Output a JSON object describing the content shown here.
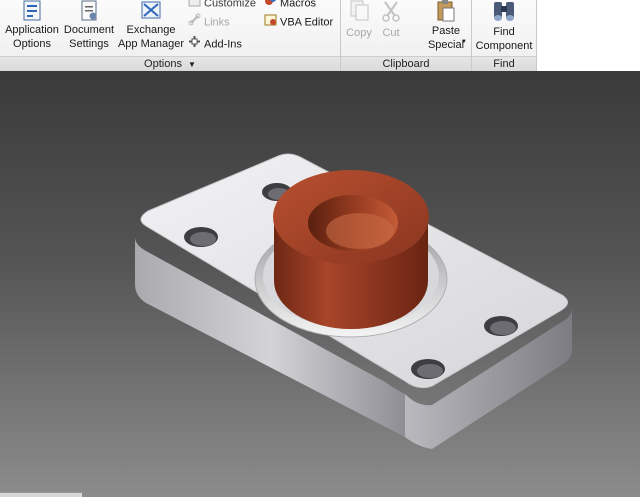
{
  "ribbon": {
    "options_panel": {
      "title": "Options",
      "application_options": [
        "Application",
        "Options"
      ],
      "document_settings": [
        "Document",
        "Settings"
      ],
      "exchange_app_manager": [
        "Exchange",
        "App Manager"
      ],
      "customize": "Customize",
      "links": "Links",
      "add_ins": "Add-Ins",
      "macros": "Macros",
      "vba_editor": "VBA Editor"
    },
    "clipboard_panel": {
      "title": "Clipboard",
      "copy": "Copy",
      "cut": "Cut",
      "paste_special": [
        "Paste",
        "Special"
      ]
    },
    "find_panel": {
      "title": "Find",
      "find_component": [
        "Find",
        "Component"
      ]
    }
  },
  "colors": {
    "part_body": "#e2e2e6",
    "bushing": "#9b3a1f",
    "viewport_top": "#3a3a3a",
    "viewport_bottom": "#8c8c8c"
  }
}
